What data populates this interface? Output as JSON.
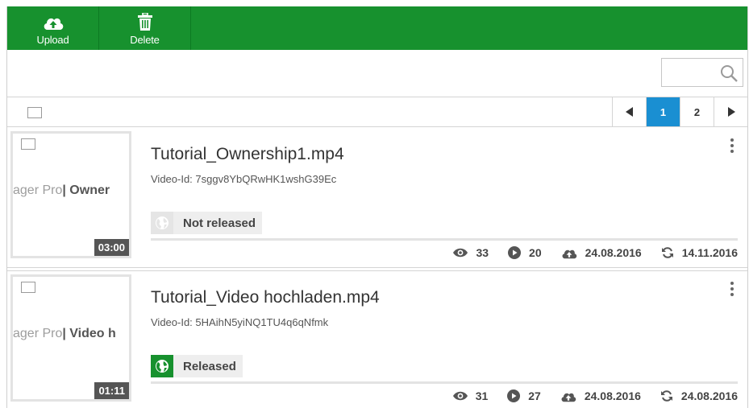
{
  "toolbar": {
    "upload_label": "Upload",
    "delete_label": "Delete"
  },
  "search": {
    "value": "",
    "placeholder": ""
  },
  "pagination": {
    "pages": [
      "1",
      "2"
    ],
    "current_page": "1"
  },
  "colors": {
    "toolbar_bg": "#17912e",
    "active_page": "#1a8fd2",
    "released": "#17912e"
  },
  "videos": [
    {
      "title": "Tutorial_Ownership1.mp4",
      "video_id": "Video-Id: 7sggv8YbQRwHK1wshG39Ec",
      "thumb_text_light": "ager Pro",
      "thumb_text_bold": "| Owner",
      "duration": "03:00",
      "status": "Not released",
      "views": "33",
      "plays": "20",
      "uploaded": "24.08.2016",
      "updated": "14.11.2016"
    },
    {
      "title": "Tutorial_Video hochladen.mp4",
      "video_id": "Video-Id: 5HAihN5yiNQ1TU4q6qNfmk",
      "thumb_text_light": "ager Pro",
      "thumb_text_bold": "| Video h",
      "duration": "01:11",
      "status": "Released",
      "views": "31",
      "plays": "27",
      "uploaded": "24.08.2016",
      "updated": "24.08.2016"
    }
  ]
}
